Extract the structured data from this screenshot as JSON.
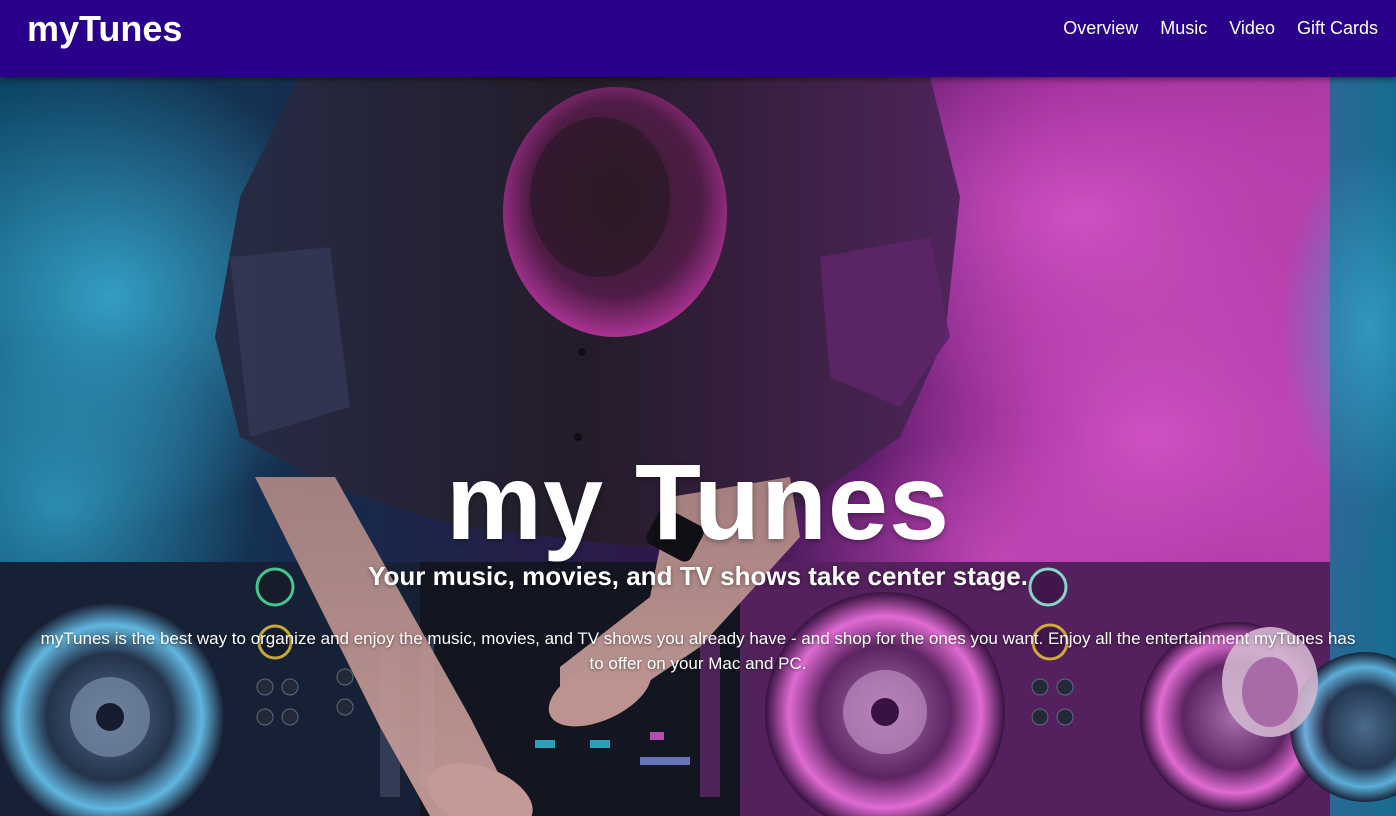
{
  "nav": {
    "brand": "myTunes",
    "links": [
      {
        "label": "Overview"
      },
      {
        "label": "Music"
      },
      {
        "label": "Video"
      },
      {
        "label": "Gift Cards"
      }
    ]
  },
  "hero": {
    "title": "my Tunes",
    "subtitle": "Your music, movies, and TV shows take center stage.",
    "description": "myTunes is the best way to organize and enjoy the music, movies, and TV shows you already have - and shop for the ones you want. Enjoy all the entertainment myTunes has to offer on your Mac and PC.",
    "image": "dj-at-turntables-photo"
  },
  "colors": {
    "navbar": "#28008a",
    "text": "#ffffff",
    "smoke_left": "#1fa4d6",
    "smoke_right": "#e040d0"
  }
}
